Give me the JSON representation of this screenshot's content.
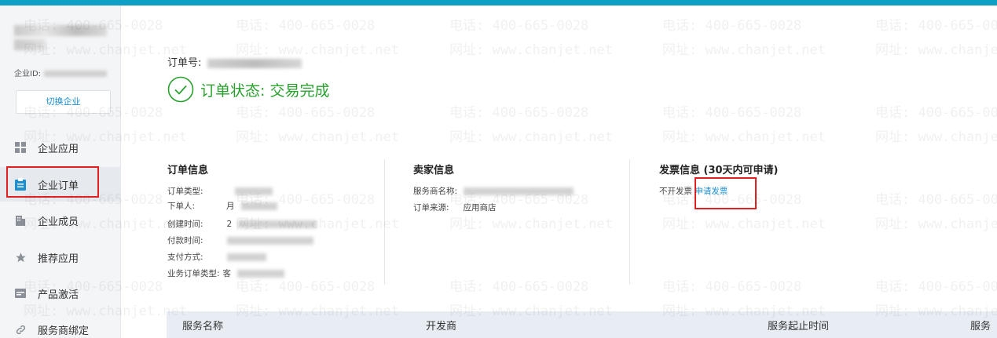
{
  "sidebar": {
    "company_id_label": "企业ID:",
    "switch_label": "切换企业",
    "items": [
      {
        "label": "企业应用",
        "icon": "grid-icon"
      },
      {
        "label": "企业订单",
        "icon": "clipboard-icon"
      },
      {
        "label": "企业成员",
        "icon": "building-icon"
      },
      {
        "label": "推荐应用",
        "icon": "star-icon"
      },
      {
        "label": "产品激活",
        "icon": "card-icon"
      },
      {
        "label": "服务商绑定",
        "icon": "link-icon"
      }
    ]
  },
  "order": {
    "number_label": "订单号:",
    "status_text": "订单状态: 交易完成"
  },
  "order_info": {
    "title": "订单信息",
    "fields": [
      {
        "label": "订单类型:",
        "value": ""
      },
      {
        "label": "下单人:",
        "value": "月"
      },
      {
        "label": "创建时间:",
        "value": "2"
      },
      {
        "label": "付款时间:",
        "value": ""
      },
      {
        "label": "支付方式:",
        "value": ""
      },
      {
        "label": "业务订单类型:",
        "value": "客"
      }
    ]
  },
  "seller_info": {
    "title": "卖家信息",
    "fields": [
      {
        "label": "服务商名称:",
        "value": ""
      },
      {
        "label": "订单来源:",
        "value": "应用商店"
      }
    ]
  },
  "invoice_info": {
    "title": "发票信息 (30天内可申请)",
    "status": "不开发票",
    "apply_link": "申请发票"
  },
  "table": {
    "headers": [
      "服务名称",
      "开发商",
      "服务起止时间",
      "服务"
    ]
  },
  "watermark": {
    "phone": "电话: 400-665-0028",
    "site": "网址: www.chanjet.net"
  },
  "colors": {
    "accent": "#1a8fd1",
    "success": "#2aa12f",
    "topbar": "#0e9fc5",
    "highlight": "#e02020"
  }
}
